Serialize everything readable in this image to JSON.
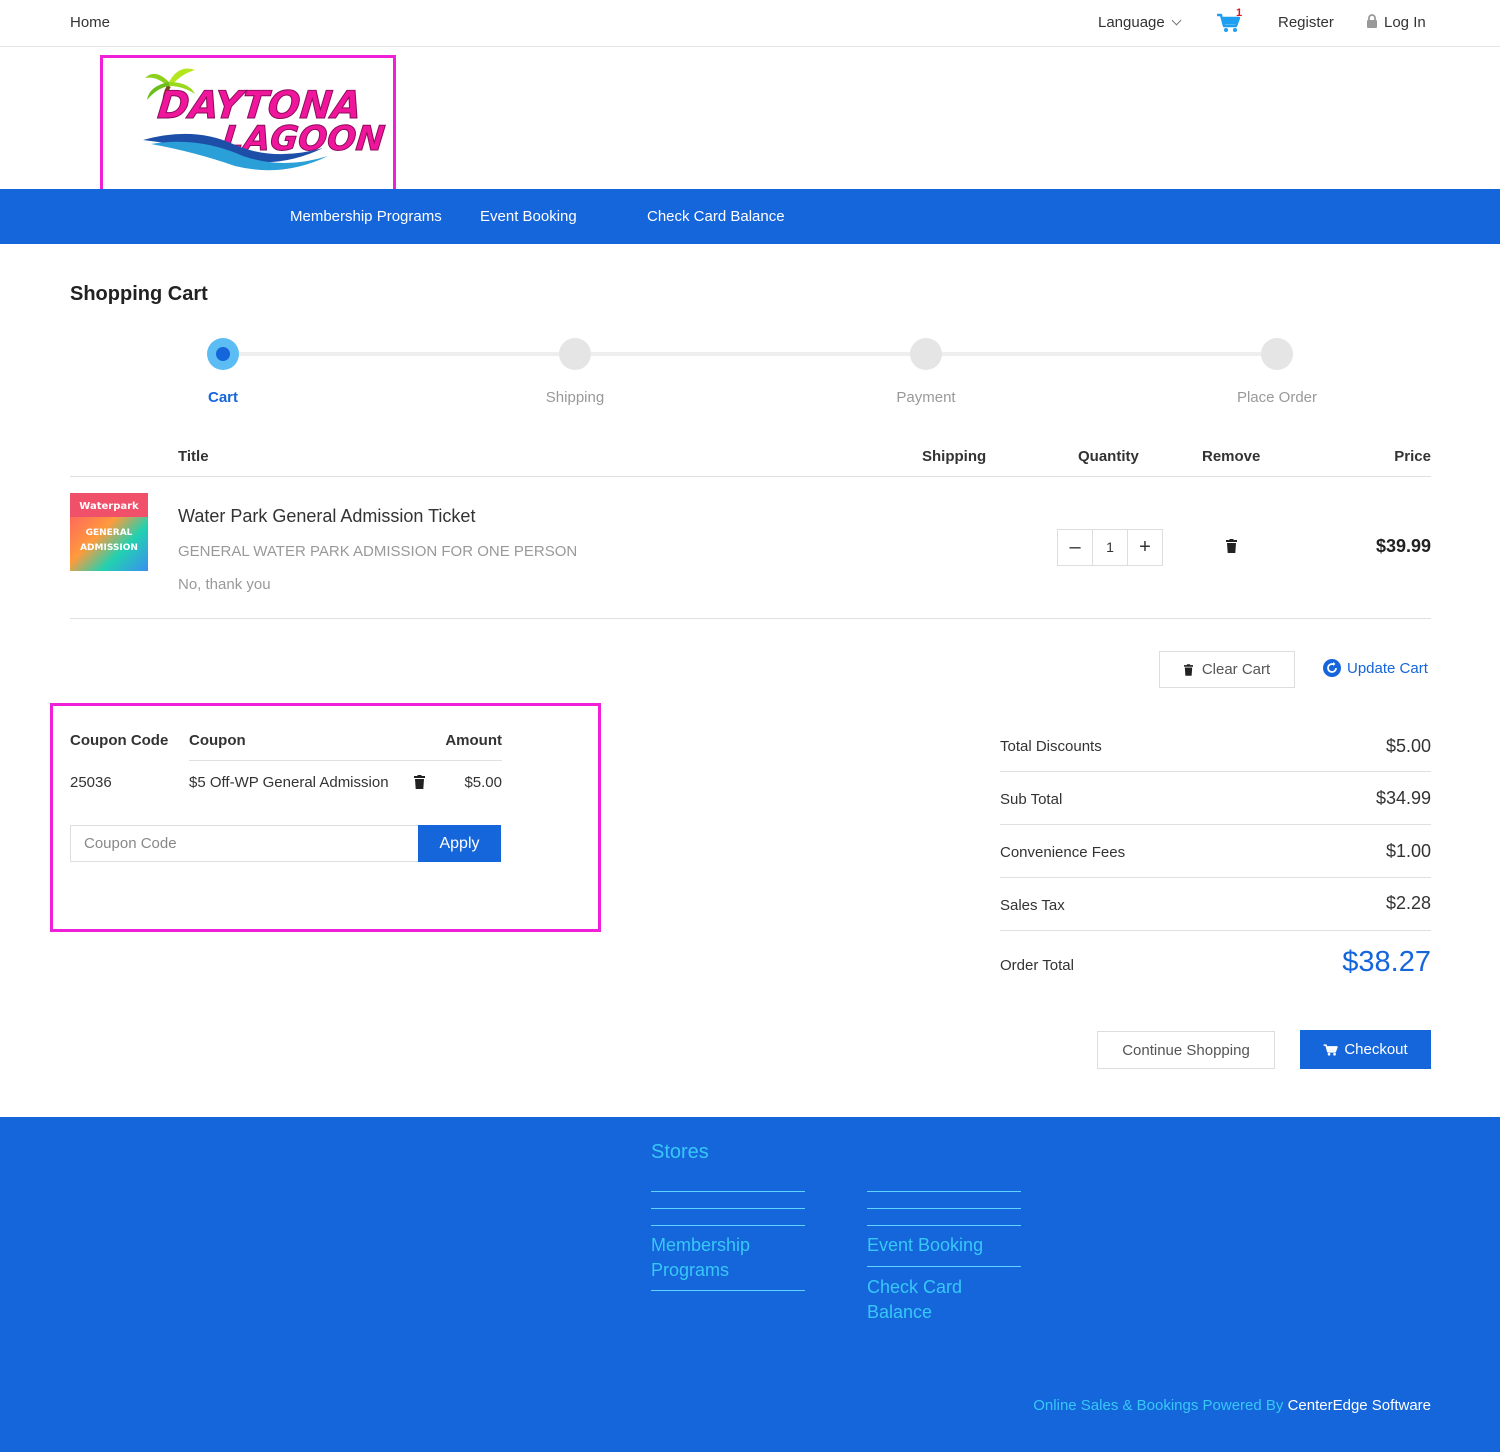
{
  "topbar": {
    "home": "Home",
    "language": "Language",
    "cart_count": "1",
    "register": "Register",
    "login": "Log In"
  },
  "logo": {
    "line1": "DAYTONA",
    "line2": "LAGOON",
    "color": "#f0169b"
  },
  "nav": {
    "items": [
      "Membership Programs",
      "Event Booking",
      "Check Card Balance"
    ]
  },
  "page": {
    "title": "Shopping Cart"
  },
  "steps": {
    "items": [
      "Cart",
      "Shipping",
      "Payment",
      "Place Order"
    ],
    "active_index": 0
  },
  "cart_table": {
    "headers": {
      "title": "Title",
      "shipping": "Shipping",
      "quantity": "Quantity",
      "remove": "Remove",
      "price": "Price"
    },
    "item": {
      "thumb_lines": [
        "Waterpark",
        "GENERAL",
        "ADMISSION"
      ],
      "title": "Water Park General Admission Ticket",
      "description": "GENERAL WATER PARK ADMISSION FOR ONE PERSON",
      "option": "No, thank you",
      "quantity": "1",
      "price": "$39.99"
    },
    "clear_cart": "Clear Cart",
    "update_cart": "Update Cart"
  },
  "coupons": {
    "headers": {
      "code": "Coupon Code",
      "coupon": "Coupon",
      "amount": "Amount"
    },
    "row": {
      "code": "25036",
      "coupon": "$5 Off-WP General Admission",
      "amount": "$5.00"
    },
    "input_placeholder": "Coupon Code",
    "apply": "Apply"
  },
  "totals": {
    "total_discounts_label": "Total Discounts",
    "total_discounts": "$5.00",
    "sub_total_label": "Sub Total",
    "sub_total": "$34.99",
    "convenience_fees_label": "Convenience Fees",
    "convenience_fees": "$1.00",
    "sales_tax_label": "Sales Tax",
    "sales_tax": "$2.28",
    "order_total_label": "Order Total",
    "order_total": "$38.27"
  },
  "actions": {
    "continue_shopping": "Continue Shopping",
    "checkout": "Checkout"
  },
  "footer": {
    "stores_title": "Stores",
    "col1_link1": "Membership Programs",
    "col2_link1": "Event Booking",
    "col2_link2": "Check Card Balance",
    "powered_by": "Online Sales & Bookings Powered By",
    "company": "CenterEdge Software"
  },
  "colors": {
    "primary": "#1565db",
    "highlight_box": "#f020d8",
    "footer_link": "#37c8f8",
    "step_active_ring": "#5cbdf5"
  }
}
